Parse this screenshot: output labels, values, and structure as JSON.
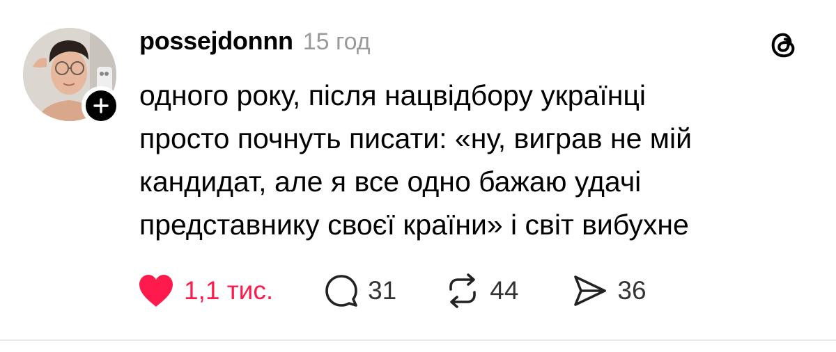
{
  "post": {
    "username": "possejdonnn",
    "time": "15 год",
    "text_lines": [
      "одного року, після нацвідбору українці",
      "просто почнуть писати: «ну, виграв не мій",
      "кандидат, але я все одно бажаю удачі",
      "представнику своєї країни» і світ вибухне"
    ],
    "liked": true,
    "stats": {
      "likes": "1,1 тис.",
      "replies": "31",
      "reposts": "44",
      "shares": "36"
    }
  },
  "icons": {
    "like": "heart-filled-icon",
    "reply": "speech-bubble-icon",
    "repost": "repost-arrows-icon",
    "share": "paper-plane-icon",
    "app": "threads-logo-icon",
    "follow": "plus-icon"
  },
  "colors": {
    "like_accent": "#ff1a4d",
    "muted_text": "#9a9a9a",
    "divider": "#e8e8e8"
  }
}
